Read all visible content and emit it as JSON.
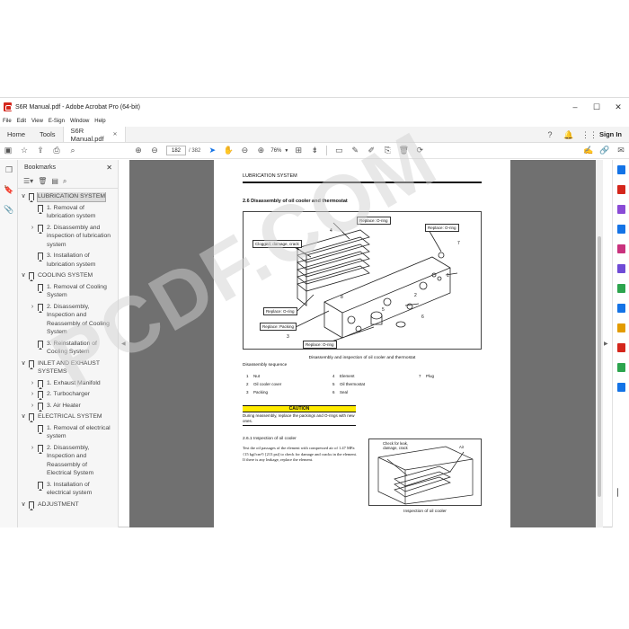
{
  "window": {
    "title": "S6R Manual.pdf - Adobe Acrobat Pro (64-bit)",
    "minimize": "–",
    "maximize": "☐",
    "close": "✕"
  },
  "menu": [
    "File",
    "Edit",
    "View",
    "E-Sign",
    "Window",
    "Help"
  ],
  "tabs": {
    "home": "Home",
    "tools": "Tools",
    "document": "S6R Manual.pdf",
    "doc_close": "✕",
    "sign_in": "Sign In"
  },
  "toolbar": {
    "current_page": "182",
    "total_pages": "/ 382",
    "zoom": "76%"
  },
  "bookmarks": {
    "title": "Bookmarks",
    "close": "✕",
    "items": [
      {
        "level": 0,
        "chevron": "∨",
        "label": "LUBRICATION SYSTEM",
        "selected": true
      },
      {
        "level": 1,
        "chevron": "",
        "label": "1. Removal of lubrication system"
      },
      {
        "level": 1,
        "chevron": "›",
        "label": "2. Disassembly and inspection of lubrication system"
      },
      {
        "level": 1,
        "chevron": "",
        "label": "3. Installation of lubrication system"
      },
      {
        "level": 0,
        "chevron": "∨",
        "label": "COOLING SYSTEM"
      },
      {
        "level": 1,
        "chevron": "",
        "label": "1. Removal of Cooling System"
      },
      {
        "level": 1,
        "chevron": "›",
        "label": "2. Disassembly, Inspection and Reassembly of Cooling System"
      },
      {
        "level": 1,
        "chevron": "",
        "label": "3. Reinstallation of Cooling System"
      },
      {
        "level": 0,
        "chevron": "∨",
        "label": "INLET AND EXHAUST SYSTEMS"
      },
      {
        "level": 1,
        "chevron": "›",
        "label": "1. Exhaust Manifold"
      },
      {
        "level": 1,
        "chevron": "›",
        "label": "2. Turbocharger"
      },
      {
        "level": 1,
        "chevron": "›",
        "label": "3. Air Heater"
      },
      {
        "level": 0,
        "chevron": "∨",
        "label": "ELECTRICAL SYSTEM"
      },
      {
        "level": 1,
        "chevron": "",
        "label": "1. Removal of electrical system"
      },
      {
        "level": 1,
        "chevron": "›",
        "label": "2. Disassembly, Inspection and Reassembly of Electrical System"
      },
      {
        "level": 1,
        "chevron": "",
        "label": "3. Installation of electrical system"
      },
      {
        "level": 0,
        "chevron": "∨",
        "label": "ADJUSTMENT"
      }
    ]
  },
  "page": {
    "header": "LUBRICATION SYSTEM",
    "section": "2.6   Disassembly of oil cooler and thermostat",
    "callouts": [
      "Replace: O-ring",
      "Replace: O-ring",
      "Clogged, damage, crack",
      "Replace: O-ring",
      "Replace: Packing",
      "Replace: O-ring"
    ],
    "part_numbers": [
      "1",
      "2",
      "3",
      "4",
      "5",
      "6",
      "7",
      "8"
    ],
    "figure1_caption": "Disassembly and inspection of oil cooler and thermostat",
    "sequence_title": "Disassembly sequence",
    "sequence": [
      [
        "1",
        "Nut",
        "4",
        "Element",
        "7",
        "Plug"
      ],
      [
        "2",
        "Oil cooler cover",
        "5",
        "Oil thermostat",
        "",
        ""
      ],
      [
        "3",
        "Packing",
        "6",
        "Seal",
        "",
        ""
      ]
    ],
    "caution_title": "CAUTION",
    "caution_text": "During reassembly, replace the packings and O-rings with new ones.",
    "subsection": "2.6.1   Inspection of oil cooler",
    "subsection_text": "Test the oil passages of the element with compressed air of 1.47 MPa {15 kgf/cm²} [213 psi] to check for damage and cracks in the element. If there is any leakage, replace the element.",
    "figure2_label": "Check for leak, damage, crack",
    "figure2_air": "Air",
    "figure2_caption": "Inspection of oil cooler",
    "watermark": "PCDF.COM"
  },
  "colors": {
    "accent": "#1473e6",
    "acrobat_red": "#d4261c",
    "caution_yellow": "#ffeb00",
    "doc_background": "#707070"
  }
}
